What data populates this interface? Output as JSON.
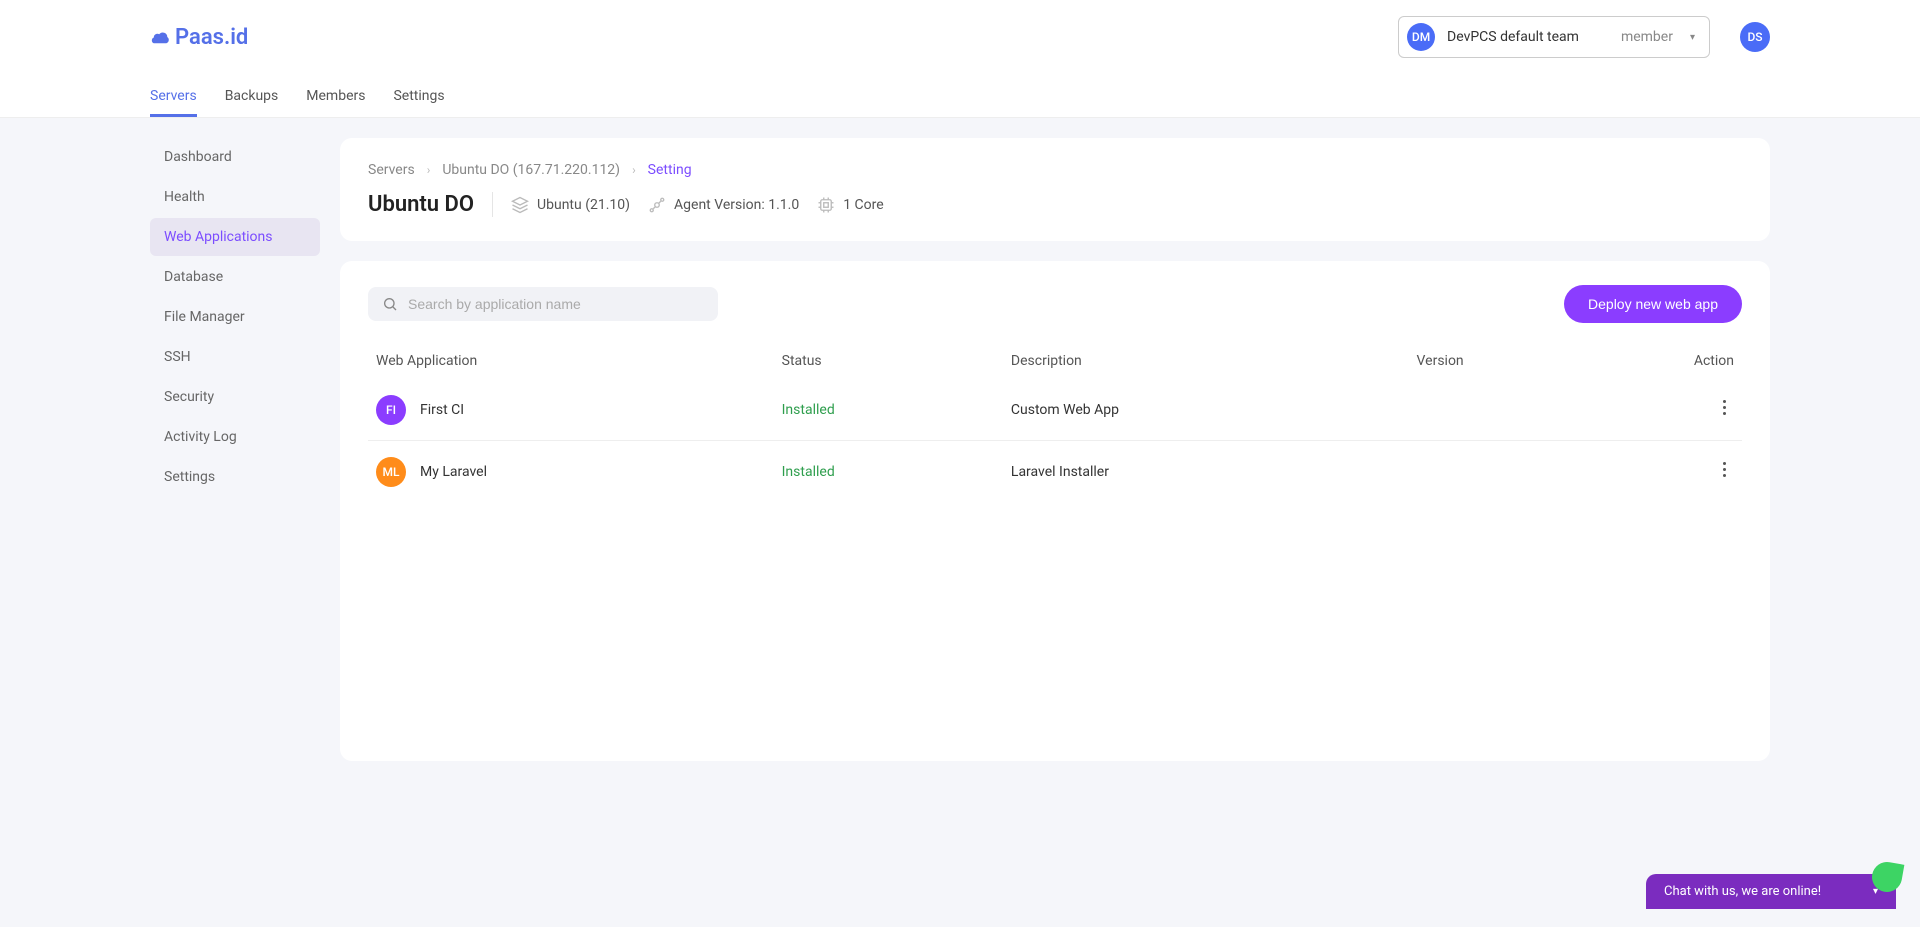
{
  "brand": "Paas.id",
  "header": {
    "team": {
      "avatar": "DM",
      "name": "DevPCS default team",
      "role": "member"
    },
    "user_avatar": "DS"
  },
  "nav_tabs": [
    {
      "label": "Servers",
      "active": true
    },
    {
      "label": "Backups",
      "active": false
    },
    {
      "label": "Members",
      "active": false
    },
    {
      "label": "Settings",
      "active": false
    }
  ],
  "sidebar": [
    {
      "label": "Dashboard",
      "active": false
    },
    {
      "label": "Health",
      "active": false
    },
    {
      "label": "Web Applications",
      "active": true
    },
    {
      "label": "Database",
      "active": false
    },
    {
      "label": "File Manager",
      "active": false
    },
    {
      "label": "SSH",
      "active": false
    },
    {
      "label": "Security",
      "active": false
    },
    {
      "label": "Activity Log",
      "active": false
    },
    {
      "label": "Settings",
      "active": false
    }
  ],
  "breadcrumb": [
    {
      "label": "Servers",
      "current": false
    },
    {
      "label": "Ubuntu DO (167.71.220.112)",
      "current": false
    },
    {
      "label": "Setting",
      "current": true
    }
  ],
  "server": {
    "title": "Ubuntu DO",
    "os": "Ubuntu (21.10)",
    "agent_version": "Agent Version: 1.1.0",
    "cores": "1 Core"
  },
  "search": {
    "placeholder": "Search by application name"
  },
  "deploy_button": "Deploy new web app",
  "table": {
    "headers": {
      "app": "Web Application",
      "status": "Status",
      "description": "Description",
      "version": "Version",
      "action": "Action"
    },
    "rows": [
      {
        "avatar": "FI",
        "avatar_color": "#8b3dff",
        "name": "First CI",
        "status": "Installed",
        "description": "Custom Web App",
        "version": ""
      },
      {
        "avatar": "ML",
        "avatar_color": "#ff8c1a",
        "name": "My Laravel",
        "status": "Installed",
        "description": "Laravel Installer",
        "version": ""
      }
    ]
  },
  "chat": {
    "label": "Chat with us, we are online!"
  }
}
